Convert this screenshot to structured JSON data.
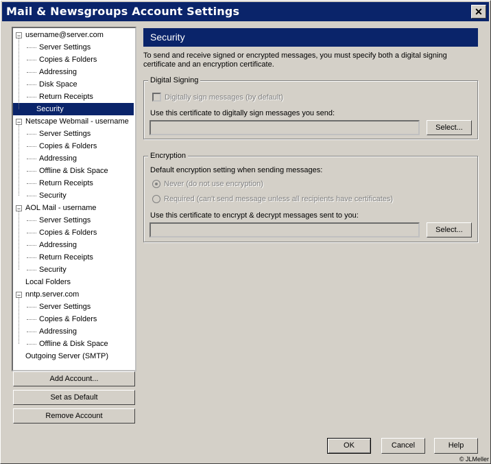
{
  "window": {
    "title": "Mail & Newsgroups Account Settings",
    "close_glyph": "✕"
  },
  "tree": {
    "accounts": [
      {
        "label": "username@server.com",
        "toggle": "−",
        "children": [
          "Server Settings",
          "Copies & Folders",
          "Addressing",
          "Disk Space",
          "Return Receipts",
          "Security"
        ]
      },
      {
        "label": "Netscape Webmail - username",
        "toggle": "−",
        "children": [
          "Server Settings",
          "Copies & Folders",
          "Addressing",
          "Offline & Disk Space",
          "Return Receipts",
          "Security"
        ]
      },
      {
        "label": "AOL Mail - username",
        "toggle": "−",
        "children": [
          "Server Settings",
          "Copies & Folders",
          "Addressing",
          "Return Receipts",
          "Security"
        ]
      },
      {
        "label": "Local Folders",
        "toggle": "",
        "children": []
      },
      {
        "label": "nntp.server.com",
        "toggle": "−",
        "children": [
          "Server Settings",
          "Copies & Folders",
          "Addressing",
          "Offline & Disk Space"
        ]
      },
      {
        "label": "Outgoing Server (SMTP)",
        "toggle": "",
        "children": []
      }
    ],
    "selected": "username@server.com / Security"
  },
  "account_buttons": {
    "add": "Add Account...",
    "set_default": "Set as Default",
    "remove": "Remove Account"
  },
  "panel": {
    "title": "Security",
    "intro": "To send and receive signed or encrypted messages, you must specify both a digital signing certificate and an encryption certificate.",
    "digital_signing": {
      "legend": "Digital Signing",
      "checkbox_label": "Digitally sign messages (by default)",
      "checkbox_checked": false,
      "cert_label": "Use this certificate to digitally sign messages you send:",
      "cert_value": "",
      "select_label": "Select..."
    },
    "encryption": {
      "legend": "Encryption",
      "default_label": "Default encryption setting when sending messages:",
      "options": [
        {
          "label": "Never (do not use encryption)",
          "selected": true
        },
        {
          "label": "Required (can't send message unless all recipients have certificates)",
          "selected": false
        }
      ],
      "cert_label": "Use this certificate to encrypt & decrypt messages sent to you:",
      "cert_value": "",
      "select_label": "Select..."
    }
  },
  "footer": {
    "ok": "OK",
    "cancel": "Cancel",
    "help": "Help",
    "copyright": "© JLMeller"
  }
}
